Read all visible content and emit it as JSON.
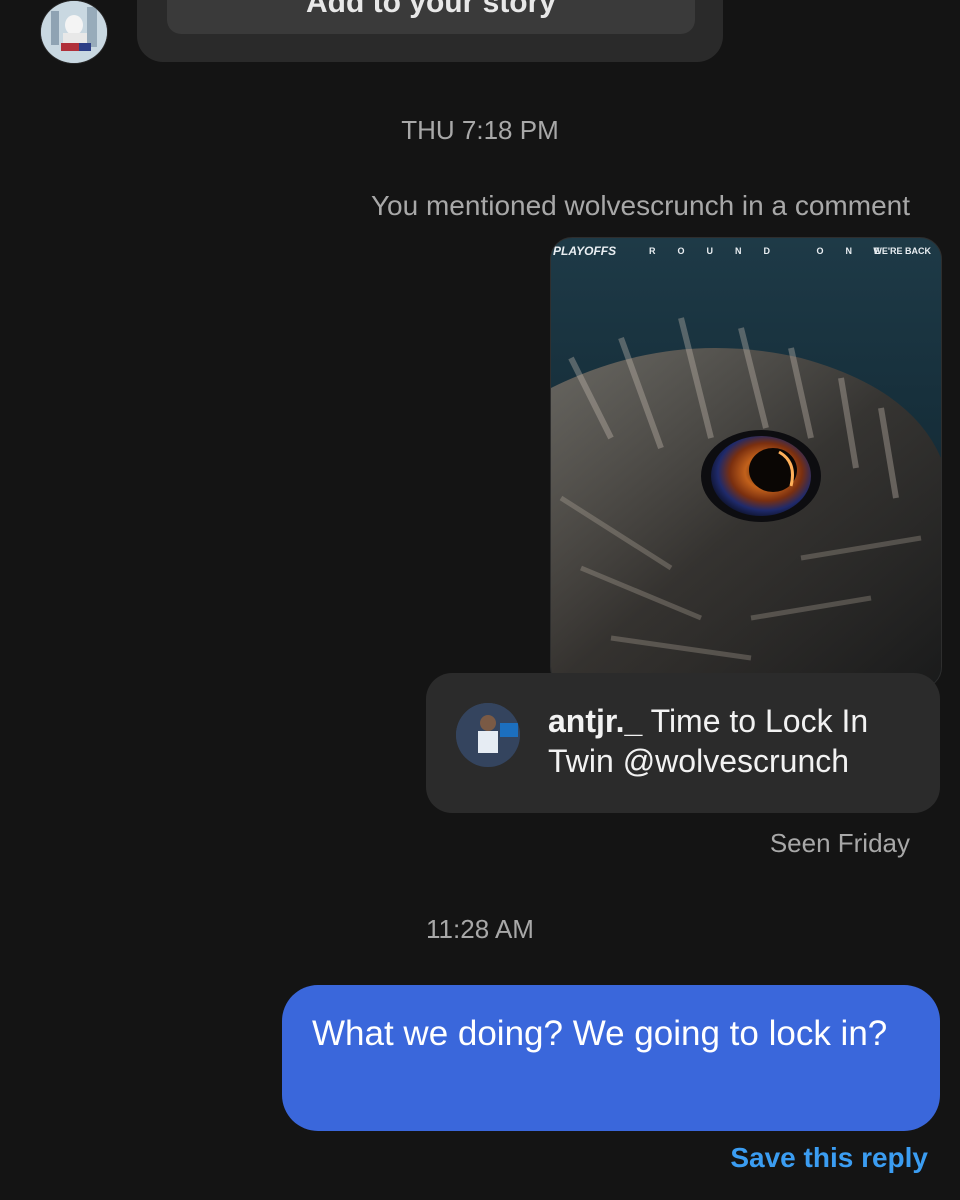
{
  "top_message": {
    "button_label": "Add to your story"
  },
  "timestamps": {
    "first": "THU 7:18 PM",
    "second": "11:28 AM"
  },
  "mention_note": "You mentioned wolvescrunch in a comment",
  "post": {
    "header_left": "PLAYOFFS",
    "header_center": "ROUND ONE",
    "header_right": "WE'RE BACK"
  },
  "comment": {
    "username": "antjr._",
    "text": "Time to Lock In Twin @wolvescrunch"
  },
  "seen_status": "Seen Friday",
  "reply": {
    "text": "What we doing? We going to lock in?"
  },
  "save_reply_label": "Save this reply",
  "colors": {
    "background": "#141414",
    "bubble_gray": "#2b2b2b",
    "reply_blue": "#3a67db",
    "link_blue": "#3b9df2",
    "muted_text": "#a8a8a8"
  }
}
